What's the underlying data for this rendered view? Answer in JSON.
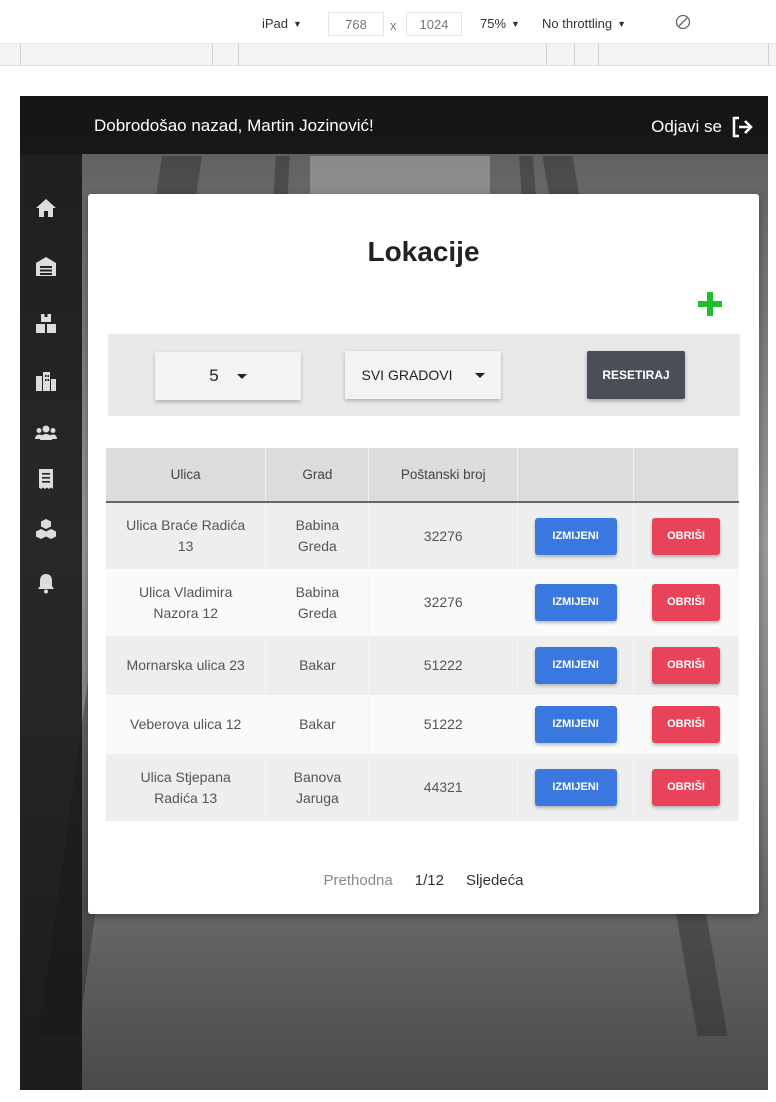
{
  "devtools": {
    "device": "iPad",
    "width": "768",
    "times": "x",
    "height": "1024",
    "zoom": "75%",
    "throttling": "No throttling"
  },
  "header": {
    "welcome": "Dobrodošao nazad, Martin Jozinović!",
    "logout_label": "Odjavi se"
  },
  "sidebar": {
    "icons": [
      "home-icon",
      "warehouse-icon",
      "boxes-icon",
      "city-icon",
      "users-icon",
      "receipt-icon",
      "cubes-icon",
      "bell-icon"
    ]
  },
  "page": {
    "title": "Lokacije"
  },
  "filters": {
    "page_size": "5",
    "city": "SVI GRADOVI",
    "reset_label": "RESETIRAJ"
  },
  "table": {
    "headers": [
      "Ulica",
      "Grad",
      "Poštanski broj",
      "",
      ""
    ],
    "rows": [
      {
        "street": "Ulica Braće Radića 13",
        "city": "Babina Greda",
        "zip": "32276",
        "edit": "IZMIJENI",
        "delete": "OBRIŠI"
      },
      {
        "street": "Ulica Vladimira Nazora 12",
        "city": "Babina Greda",
        "zip": "32276",
        "edit": "IZMIJENI",
        "delete": "OBRIŠI"
      },
      {
        "street": "Mornarska ulica 23",
        "city": "Bakar",
        "zip": "51222",
        "edit": "IZMIJENI",
        "delete": "OBRIŠI"
      },
      {
        "street": "Veberova ulica 12",
        "city": "Bakar",
        "zip": "51222",
        "edit": "IZMIJENI",
        "delete": "OBRIŠI"
      },
      {
        "street": "Ulica Stjepana Radića 13",
        "city": "Banova Jaruga",
        "zip": "44321",
        "edit": "IZMIJENI",
        "delete": "OBRIŠI"
      }
    ]
  },
  "pagination": {
    "prev_label": "Prethodna",
    "page": "1/12",
    "next_label": "Sljedeća"
  },
  "colors": {
    "edit": "#3a78e0",
    "delete": "#e8435a",
    "add": "#1fbf2e",
    "reset": "#4b4e56"
  }
}
